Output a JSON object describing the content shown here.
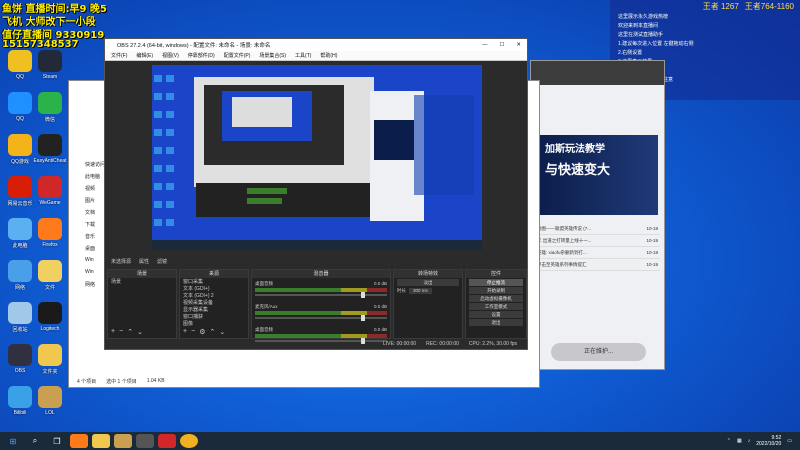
{
  "overlay": {
    "line1": "鱼饼 直播时间:早9 晚5",
    "line2": "飞机 大师改下一小段",
    "line3": "值仔直播间 9330919",
    "line4": "15157348537"
  },
  "desktop_icons": [
    {
      "label": "QQ",
      "color": "#f0c020"
    },
    {
      "label": "Steam",
      "color": "#222a3a"
    },
    {
      "label": "QQ",
      "color": "#1e90ff"
    },
    {
      "label": "微信",
      "color": "#2ab34a"
    },
    {
      "label": "QQ游戏",
      "color": "#f5b31a"
    },
    {
      "label": "EasyAntiCheat",
      "color": "#222222"
    },
    {
      "label": "网易云音乐",
      "color": "#d81e06"
    },
    {
      "label": "WeGame",
      "color": "#d02828"
    },
    {
      "label": "此电脑",
      "color": "#5ab0f0"
    },
    {
      "label": "Firefox",
      "color": "#ff7a1a"
    },
    {
      "label": "网络",
      "color": "#4aa0e8"
    },
    {
      "label": "文件",
      "color": "#f0d060"
    },
    {
      "label": "回收站",
      "color": "#a0c8e8"
    },
    {
      "label": "Logitech",
      "color": "#1a1a1a"
    },
    {
      "label": "OBS",
      "color": "#303040"
    },
    {
      "label": "文件夹",
      "color": "#f0c850"
    },
    {
      "label": "Bilibili",
      "color": "#3aa0e8"
    },
    {
      "label": "LOL",
      "color": "#c8a050"
    }
  ],
  "stream_bar": {
    "top_left": "王者 1267",
    "top_right": "王者764-1160",
    "rows": [
      "这里展示永久游戏热榜",
      "欢迎来到本直播间",
      "这里在测试直播助手",
      "1.建议每次进入位置 左键拖动右侧",
      "2.右侧设置",
      "3.这里表示效果",
      "4.如有问题",
      "这里测试中央配置请注意",
      "欢迎来到本直播间"
    ]
  },
  "right_panel": {
    "banner_line1": "加斯玩法教学",
    "banner_line2": "与快速变大",
    "list": [
      {
        "title": "地图——联盟英雄传说 (7...",
        "date": "10-19"
      },
      {
        "title": "年 出道之打转量上线十一...",
        "date": "10-19"
      },
      {
        "title": "英雄: xiaofu杂删新到打...",
        "date": "10-19"
      },
      {
        "title": "单击至英雄系列事情提汇",
        "date": "10-19"
      }
    ],
    "maintenance_button": "正在维护..."
  },
  "explorer": {
    "sidebar": [
      "快速访问",
      "此电脑",
      "视频",
      "图片",
      "文档",
      "下载",
      "音乐",
      "桌面",
      "Win",
      "Win",
      "网络"
    ],
    "status_count": "4 个项目",
    "status_selected": "选中 1 个项目",
    "status_size": "1.04 KB"
  },
  "obs": {
    "title": "OBS 27.2.4 (64-bit, windows) - 配置文件: 未命名 - 场景: 未命名",
    "menu": [
      "文件(F)",
      "编辑(E)",
      "视图(V)",
      "停靠部件(D)",
      "配置文件(P)",
      "场景集合(S)",
      "工具(T)",
      "帮助(H)"
    ],
    "dock_bar": [
      "未选择源",
      "属性",
      "滤镜"
    ],
    "scenes_header": "场景",
    "scenes": [
      "场景"
    ],
    "sources_header": "来源",
    "sources": [
      "窗口采集",
      "文本 (GDI+)",
      "文本 (GDI+) 2",
      "视频采集设备",
      "显示器采集",
      "窗口捕获",
      "图像"
    ],
    "mixer_header": "混音器",
    "mixer": [
      {
        "name": "桌面音频",
        "db": "0.0 dB"
      },
      {
        "name": "麦克风/Aux",
        "db": "0.0 dB"
      },
      {
        "name": "桌面音频",
        "db": "0.0 dB"
      }
    ],
    "transitions_header": "转场特效",
    "transition_type": "淡出",
    "duration_label": "时长",
    "duration_value": "300 ms",
    "controls_header": "控件",
    "controls": [
      "停止推流",
      "开始录制",
      "启动虚拟摄像机",
      "工作室模式",
      "设置",
      "退出"
    ],
    "status": {
      "live": "LIVE: 00:00:00",
      "rec": "REC: 00:00:00",
      "cpu": "CPU: 2.2%, 30.00 fps"
    }
  },
  "taskbar": {
    "time": "9:52",
    "date": "2022/10/20"
  }
}
